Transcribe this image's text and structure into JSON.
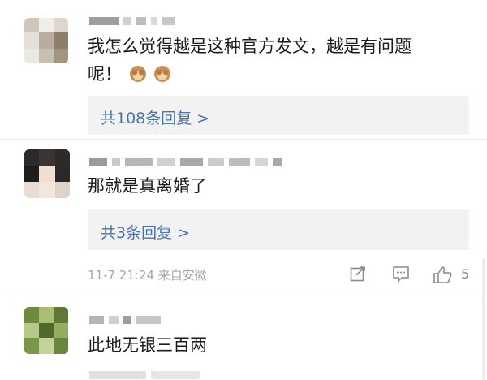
{
  "comments": [
    {
      "text_line1": "我怎么觉得越是这种官方发文，越是有问题",
      "text_line2": "呢！",
      "reply_link": "共108条回复 >"
    },
    {
      "text": "那就是真离婚了",
      "reply_link": "共3条回复 >",
      "time_location": "11-7 21:24 来自安徽",
      "like_count": "5"
    },
    {
      "text": "此地无银三百两"
    }
  ],
  "icons": {
    "emoji": "see-no-evil-monkey-icon",
    "share": "share-icon",
    "comment": "comment-icon",
    "like": "thumbs-up-icon"
  },
  "colors": {
    "link": "#4a73a8",
    "reply_bg": "#f2f2f2",
    "meta": "#a6a6a6",
    "icon": "#8a8a8a"
  }
}
